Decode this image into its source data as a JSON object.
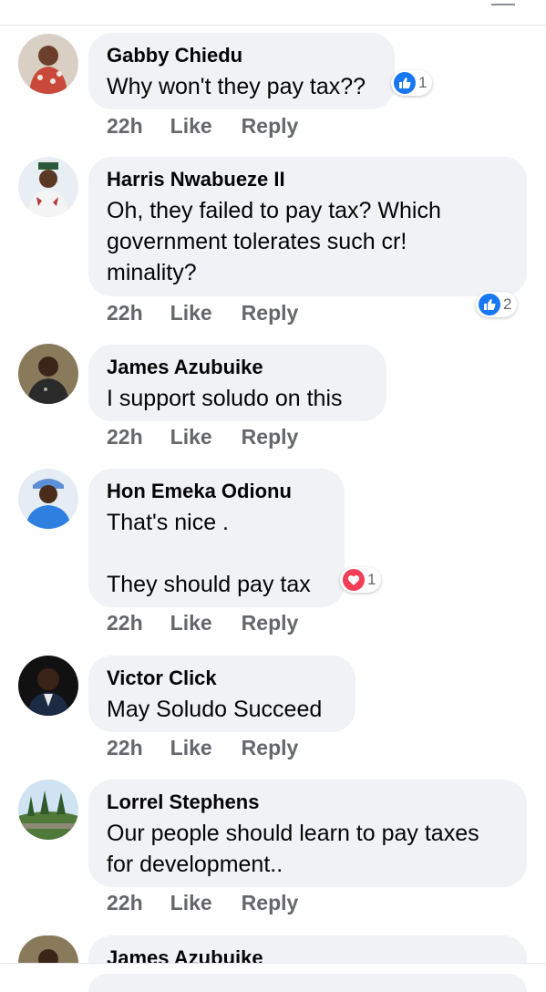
{
  "comments": [
    {
      "author": "Gabby Chiedu",
      "text": "Why won't they pay tax??",
      "time": "22h",
      "like": "Like",
      "reply": "Reply",
      "reaction": {
        "type": "like",
        "count": "1"
      }
    },
    {
      "author": "Harris Nwabueze II",
      "text": "Oh, they failed to pay tax? Which\ngovernment tolerates such cr!\nminality?",
      "time": "22h",
      "like": "Like",
      "reply": "Reply",
      "reaction": {
        "type": "like",
        "count": "2"
      }
    },
    {
      "author": "James Azubuike",
      "text": "I support soludo on this",
      "time": "22h",
      "like": "Like",
      "reply": "Reply"
    },
    {
      "author": "Hon Emeka Odionu",
      "text": "That's nice .\n\nThey should pay tax",
      "time": "22h",
      "like": "Like",
      "reply": "Reply",
      "reaction": {
        "type": "love",
        "count": "1"
      }
    },
    {
      "author": "Victor Click",
      "text": "May Soludo Succeed",
      "time": "22h",
      "like": "Like",
      "reply": "Reply"
    },
    {
      "author": "Lorrel Stephens",
      "text": "Our people should learn to pay taxes\nfor development..",
      "time": "22h",
      "like": "Like",
      "reply": "Reply"
    },
    {
      "author": "James Azubuike"
    }
  ],
  "colors": {
    "bubble": "#f0f2f5",
    "like_blue": "#1877f2",
    "love_red": "#f33e58",
    "meta_gray": "#65676b"
  }
}
